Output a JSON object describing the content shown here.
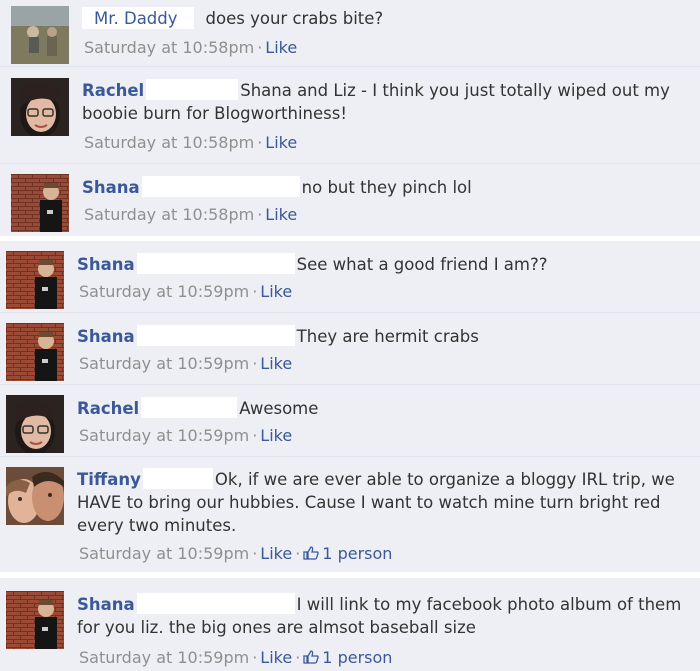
{
  "like_label": "Like",
  "comments": [
    {
      "author": "Mr. Daddy",
      "text": "does your crabs bite?",
      "time": "Saturday at 10:58pm",
      "avatar": "outdoor-photo"
    },
    {
      "author": "Rachel",
      "text": "Shana and Liz - I think you just totally wiped out my boobie burn for Blogworthiness!",
      "time": "Saturday at 10:58pm",
      "avatar": "woman-glasses"
    },
    {
      "author": "Shana",
      "text": "no but they pinch lol",
      "time": "Saturday at 10:58pm",
      "avatar": "child-brick"
    },
    {
      "author": "Shana",
      "text": "See what a good friend I am??",
      "time": "Saturday at 10:59pm",
      "avatar": "child-brick"
    },
    {
      "author": "Shana",
      "text": "They are hermit crabs",
      "time": "Saturday at 10:59pm",
      "avatar": "child-brick"
    },
    {
      "author": "Rachel",
      "text": "Awesome",
      "time": "Saturday at 10:59pm",
      "avatar": "woman-glasses"
    },
    {
      "author": "Tiffany",
      "text": "Ok, if we are ever able to organize a bloggy IRL trip, we HAVE to bring our hubbies. Cause I want to watch mine turn bright red every two minutes.",
      "time": "Saturday at 10:59pm",
      "avatar": "couple",
      "likes": "1 person"
    },
    {
      "author": "Shana",
      "text": "I will link to my facebook photo album of them for you liz. the big ones are almsot baseball size",
      "time": "Saturday at 10:59pm",
      "avatar": "child-brick",
      "likes": "1 person"
    }
  ]
}
